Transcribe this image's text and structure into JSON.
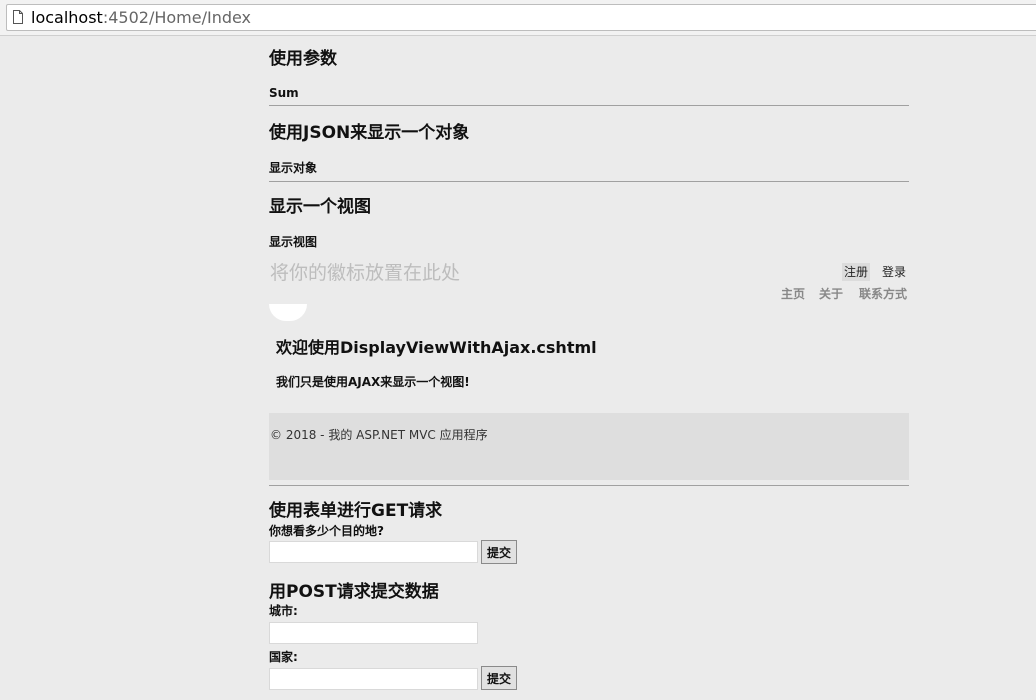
{
  "browser": {
    "url_host": "localhost",
    "url_rest": ":4502/Home/Index"
  },
  "params_section": {
    "heading": "使用参数",
    "link": "Sum"
  },
  "json_section": {
    "heading": "使用JSON来显示一个对象",
    "link": "显示对象"
  },
  "view_section": {
    "heading": "显示一个视图",
    "link": "显示视图"
  },
  "embedded_view": {
    "logo_placeholder": "将你的徽标放置在此处",
    "register": "注册",
    "login": "登录",
    "nav": [
      "主页",
      "关于",
      "联系方式"
    ],
    "welcome_title": "欢迎使用DisplayViewWithAjax.cshtml",
    "welcome_sub": "我们只是使用AJAX来显示一个视图!",
    "footer": "© 2018 - 我的 ASP.NET MVC 应用程序"
  },
  "get_form": {
    "heading": "使用表单进行GET请求",
    "label": "你想看多少个目的地?",
    "value": "",
    "submit": "提交"
  },
  "post_form": {
    "heading": "用POST请求提交数据",
    "city_label": "城市:",
    "city_value": "",
    "country_label": "国家:",
    "country_value": "",
    "submit": "提交"
  },
  "colors": {
    "page_bg": "#ebebeb",
    "footer_bg": "#dedede",
    "logo_text": "#bdbdbd",
    "nav_text": "#888888"
  }
}
